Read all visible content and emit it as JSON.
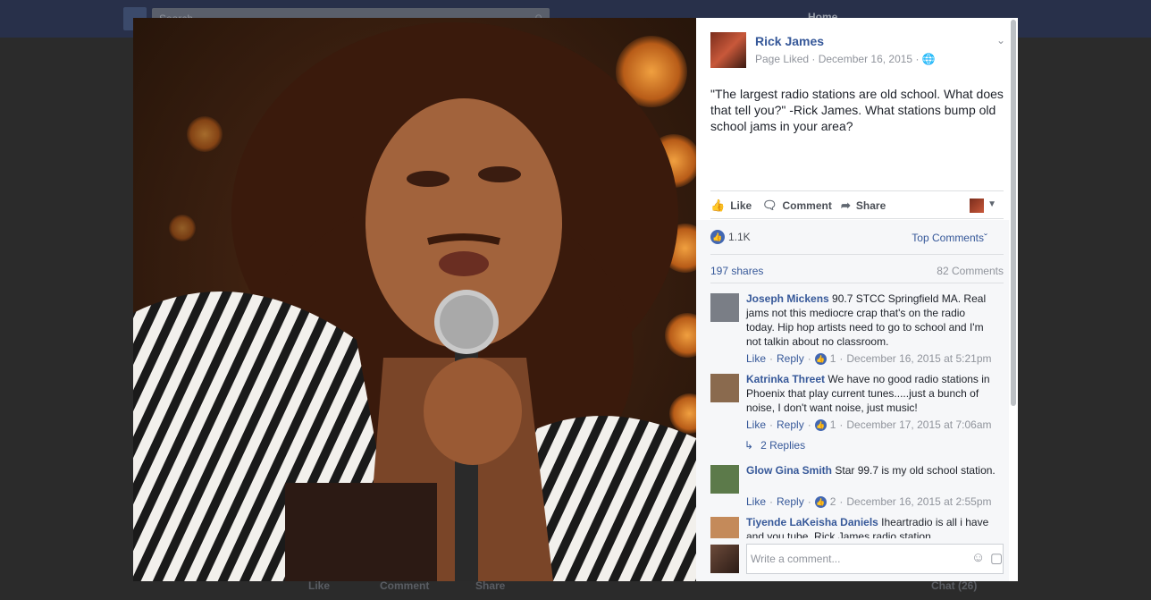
{
  "background": {
    "search_placeholder": "Search",
    "nav_home": "Home",
    "bottom_like": "Like",
    "bottom_comment": "Comment",
    "bottom_share": "Share",
    "chat": "Chat (26)"
  },
  "post": {
    "page_name": "Rick James",
    "meta": "Page Liked · December 16, 2015 · ",
    "text": "\"The largest radio stations are old school. What does that tell you?\" -Rick James. What stations bump old school jams in your area?"
  },
  "actions": {
    "like": "Like",
    "comment": "Comment",
    "share": "Share"
  },
  "stats": {
    "reactions": "1.1K",
    "top_comments": "Top Comments",
    "shares": "197 shares",
    "comments": "82 Comments"
  },
  "comments": [
    {
      "author": "Joseph Mickens",
      "text": " 90.7 STCC Springfield MA. Real jams not this mediocre crap that's on the radio today. Hip hop artists need to go to school and I'm not talkin about no classroom.",
      "like": "Like",
      "reply": "Reply",
      "likes": "1",
      "time": "December 16, 2015 at 5:21pm"
    },
    {
      "author": "Katrinka Threet",
      "text": " We have no good radio stations in Phoenix that play current tunes.....just a bunch of noise, I don't want noise, just music!",
      "like": "Like",
      "reply": "Reply",
      "likes": "1",
      "time": "December 17, 2015 at 7:06am"
    },
    {
      "author": "Glow Gina Smith",
      "text": " Star 99.7 is my old school station.",
      "like": "Like",
      "reply": "Reply",
      "likes": "2",
      "time": "December 16, 2015 at 2:55pm"
    },
    {
      "author": "Tiyende LaKeisha Daniels",
      "text": " Iheartradio is all i have and you tube. Rick James radio station"
    }
  ],
  "replies_label": "2 Replies",
  "write_placeholder": "Write a comment..."
}
